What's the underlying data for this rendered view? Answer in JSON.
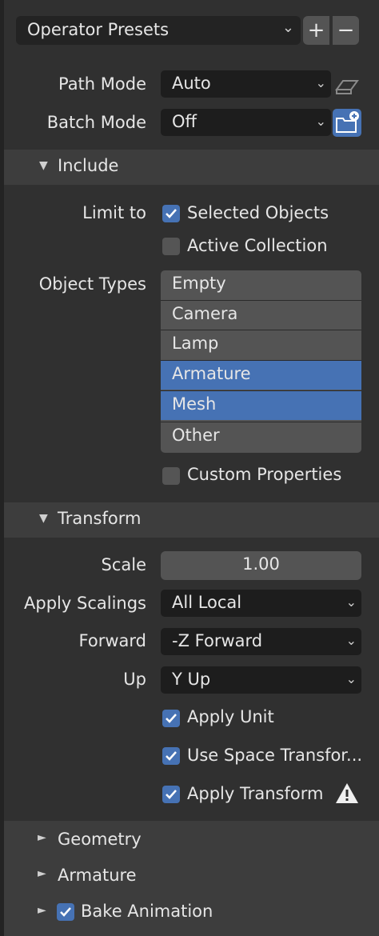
{
  "presets": {
    "label": "Operator Presets",
    "add": "+",
    "remove": "−"
  },
  "path_mode": {
    "label": "Path Mode",
    "value": "Auto"
  },
  "batch_mode": {
    "label": "Batch Mode",
    "value": "Off"
  },
  "include": {
    "title": "Include",
    "limit_to_label": "Limit to",
    "selected_objects": {
      "label": "Selected Objects",
      "checked": true
    },
    "active_collection": {
      "label": "Active Collection",
      "checked": false
    },
    "object_types_label": "Object Types",
    "object_types": [
      {
        "label": "Empty",
        "selected": false
      },
      {
        "label": "Camera",
        "selected": false
      },
      {
        "label": "Lamp",
        "selected": false
      },
      {
        "label": "Armature",
        "selected": true
      },
      {
        "label": "Mesh",
        "selected": true
      },
      {
        "label": "Other",
        "selected": false
      }
    ],
    "custom_properties": {
      "label": "Custom Properties",
      "checked": false
    }
  },
  "transform": {
    "title": "Transform",
    "scale": {
      "label": "Scale",
      "value": "1.00"
    },
    "apply_scalings": {
      "label": "Apply Scalings",
      "value": "All Local"
    },
    "forward": {
      "label": "Forward",
      "value": "-Z Forward"
    },
    "up": {
      "label": "Up",
      "value": "Y Up"
    },
    "apply_unit": {
      "label": "Apply Unit",
      "checked": true
    },
    "use_space_transform": {
      "label": "Use Space Transfor...",
      "checked": true
    },
    "apply_transform": {
      "label": "Apply Transform",
      "checked": true
    }
  },
  "geometry": {
    "title": "Geometry"
  },
  "armature": {
    "title": "Armature"
  },
  "bake_animation": {
    "title": "Bake Animation",
    "checked": true
  },
  "colors": {
    "accent": "#4672b4",
    "background": "#303030",
    "field": "#1d1d1d",
    "button": "#545454"
  }
}
